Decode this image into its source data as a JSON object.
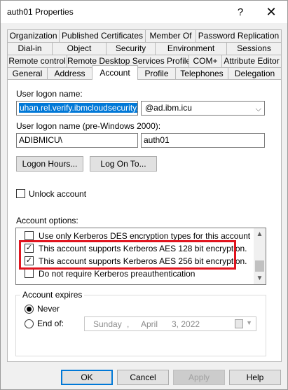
{
  "window": {
    "title": "auth01 Properties",
    "help_glyph": "?",
    "close_glyph": "✕"
  },
  "tabs": {
    "row1": [
      "Organization",
      "Published Certificates",
      "Member Of",
      "Password Replication"
    ],
    "row2": [
      "Dial-in",
      "Object",
      "Security",
      "Environment",
      "Sessions"
    ],
    "row3": [
      "Remote control",
      "Remote Desktop Services Profile",
      "COM+",
      "Attribute Editor"
    ],
    "row4": [
      "General",
      "Address",
      "Account",
      "Profile",
      "Telephones",
      "Delegation"
    ],
    "active": "Account"
  },
  "account": {
    "logon_name_label": "User logon name:",
    "logon_name_value": "uhan.rel.verify.ibmcloudsecurity.com",
    "domain_value": "@ad.ibm.icu",
    "pre2000_label": "User logon name (pre-Windows 2000):",
    "pre2000_domain": "ADIBMICU\\",
    "pre2000_user": "auth01",
    "logon_hours_button": "Logon Hours...",
    "logon_to_button": "Log On To...",
    "unlock_label": "Unlock account",
    "unlock_checked": false,
    "options_label": "Account options:",
    "options": [
      {
        "label": "Use only Kerberos DES encryption types for this account",
        "checked": false
      },
      {
        "label": "This account supports Kerberos AES 128 bit encryption.",
        "checked": true
      },
      {
        "label": "This account supports Kerberos AES 256 bit encryption.",
        "checked": true
      },
      {
        "label": "Do not require Kerberos preauthentication",
        "checked": false
      }
    ],
    "expires_label": "Account expires",
    "never_label": "Never",
    "end_of_label": "End of:",
    "expires_selected": "Never",
    "date": {
      "weekday": "Sunday",
      "sep1": ",",
      "month": "April",
      "day_year": "3, 2022"
    }
  },
  "footer": {
    "ok": "OK",
    "cancel": "Cancel",
    "apply": "Apply",
    "help": "Help"
  },
  "colors": {
    "selection": "#0078d7",
    "highlight_box": "#e0141e"
  }
}
